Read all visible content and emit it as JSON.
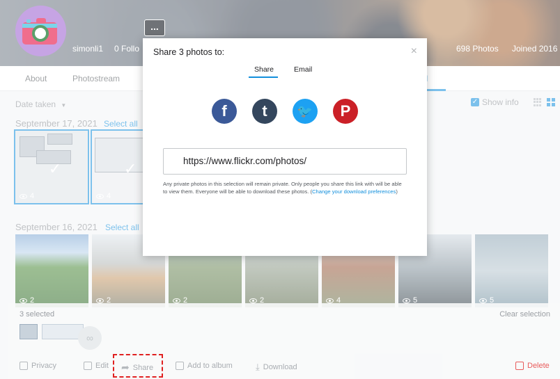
{
  "profile": {
    "username": "simonli1",
    "followers": "0 Follo",
    "photos": "698 Photos",
    "joined": "Joined 2016",
    "more_button": "..."
  },
  "nav": {
    "tabs": [
      "About",
      "Photostream"
    ],
    "active_tab_fragment": "ll"
  },
  "toolbar": {
    "sort_label": "Date taken",
    "show_info": "Show info"
  },
  "sections": [
    {
      "date": "September 17, 2021",
      "select_all": "Select all",
      "photos": [
        {
          "views": "4",
          "selected": true
        },
        {
          "views": "4",
          "selected": true
        }
      ]
    },
    {
      "date": "September 16, 2021",
      "select_all": "Select all",
      "photos": [
        {
          "views": "2"
        },
        {
          "views": "2"
        },
        {
          "views": "2"
        },
        {
          "views": "2"
        },
        {
          "views": "4"
        },
        {
          "views": "5"
        },
        {
          "views": "5"
        }
      ]
    }
  ],
  "selection_bar": {
    "count": "3 selected",
    "clear": "Clear selection",
    "actions": {
      "privacy": "Privacy",
      "edit": "Edit",
      "share": "Share",
      "add_to_album": "Add to album",
      "download": "Download",
      "delete": "Delete"
    }
  },
  "share_modal": {
    "title": "Share 3 photos to:",
    "close": "×",
    "tabs": {
      "share": "Share",
      "email": "Email"
    },
    "networks": {
      "facebook": "f",
      "tumblr": "t",
      "twitter": "🐦",
      "pinterest": "P"
    },
    "url": "https://www.flickr.com/photos/",
    "note": "Any private photos in this selection will remain private. Only people you share this link with will be able to view them. Everyone will be able to download these photos. (",
    "note_link": "Change your download preferences",
    "note_end": ")"
  },
  "colors": {
    "accent": "#128fdc",
    "facebook": "#3b5998",
    "tumblr": "#34465d",
    "twitter": "#1da1f2",
    "pinterest": "#cb2027",
    "delete": "#e85b5b",
    "highlight": "#e02020"
  }
}
